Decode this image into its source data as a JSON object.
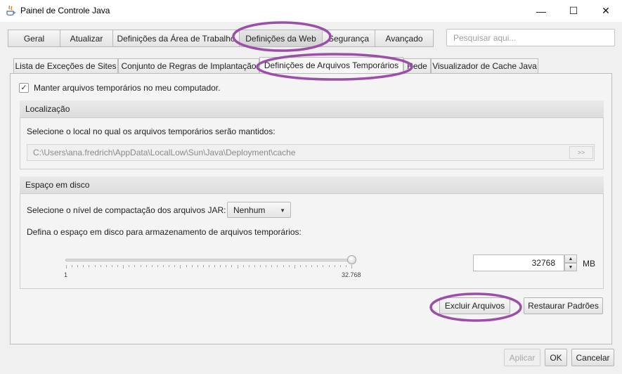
{
  "window": {
    "title": "Painel de Controle Java",
    "controls": [
      "minimize-icon",
      "maximize-icon",
      "close-icon"
    ]
  },
  "top_tabs": [
    {
      "label": "Geral",
      "selected": false
    },
    {
      "label": "Atualizar",
      "selected": false
    },
    {
      "label": "Definições da Área de Trabalho",
      "selected": false
    },
    {
      "label": "Definições da Web",
      "selected": true
    },
    {
      "label": "Segurança",
      "selected": false
    },
    {
      "label": "Avançado",
      "selected": false
    }
  ],
  "search": {
    "placeholder": "Pesquisar aqui..."
  },
  "sub_tabs": [
    {
      "label": "Lista de Exceções de Sites",
      "selected": false
    },
    {
      "label": "Conjunto de Regras de Implantação",
      "selected": false
    },
    {
      "label": "Definições de Arquivos Temporários",
      "selected": true
    },
    {
      "label": "Rede",
      "selected": false
    },
    {
      "label": "Visualizador de Cache Java",
      "selected": false
    }
  ],
  "keep_temp": {
    "label": "Manter arquivos temporários no meu computador.",
    "checked": true
  },
  "location": {
    "header": "Localização",
    "description": "Selecione o local no qual os arquivos temporários serão mantidos:",
    "path": "C:\\Users\\ana.fredrich\\AppData\\LocalLow\\Sun\\Java\\Deployment\\cache",
    "browse_label": ">>"
  },
  "disk_space": {
    "header": "Espaço em disco",
    "jar_label": "Selecione o nível de compactação dos arquivos JAR:",
    "jar_value": "Nenhum",
    "space_label": "Defina o espaço em disco para armazenamento de arquivos temporários:",
    "slider_min": "1",
    "slider_max": "32.768",
    "slider_fraction": 1.0,
    "value": "32768",
    "unit": "MB"
  },
  "actions": {
    "delete": "Excluir Arquivos",
    "restore": "Restaurar Padrões"
  },
  "footer": {
    "apply": "Aplicar",
    "ok": "OK",
    "cancel": "Cancelar"
  },
  "colors": {
    "annotation": "#9b4fa8",
    "accent_border": "#5a9fd4"
  }
}
